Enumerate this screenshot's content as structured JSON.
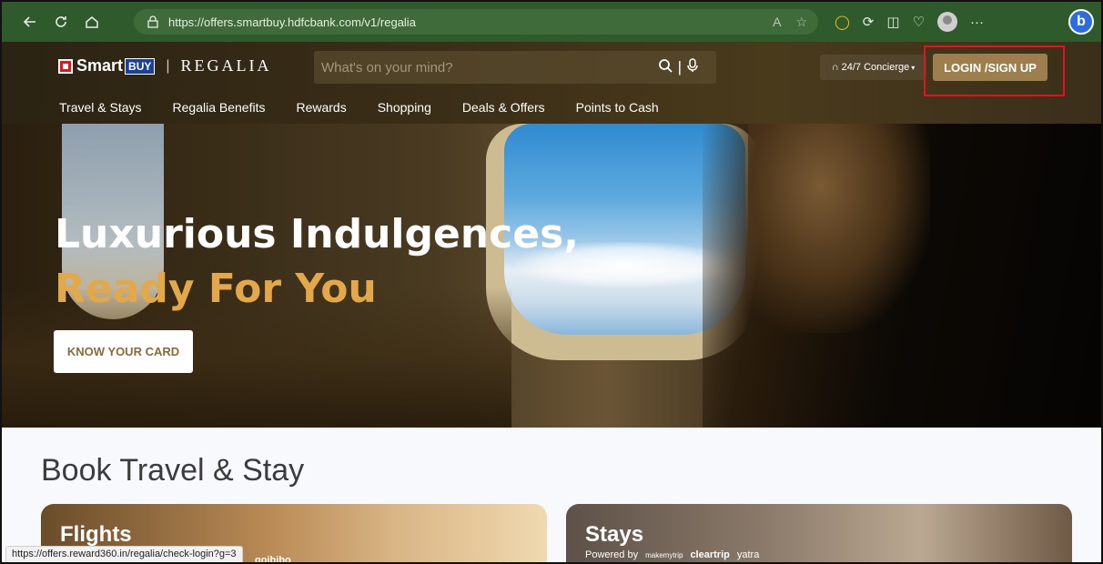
{
  "browser": {
    "url": "https://offers.smartbuy.hdfcbank.com/v1/regalia",
    "status_url": "https://offers.reward360.in/regalia/check-login?g=3"
  },
  "site": {
    "logo_smart": "Smart",
    "logo_buy": "BUY",
    "logo_regalia": "REGALIA",
    "search_placeholder": "What's on your mind?",
    "concierge_label": "24/7 Concierge",
    "login_label": "LOGIN /SIGN UP",
    "menu": [
      {
        "label": "Travel & Stays"
      },
      {
        "label": "Regalia Benefits"
      },
      {
        "label": "Rewards"
      },
      {
        "label": "Shopping"
      },
      {
        "label": "Deals & Offers"
      },
      {
        "label": "Points to Cash"
      }
    ]
  },
  "hero": {
    "title_line1": "Luxurious Indulgences,",
    "title_line2": "Ready For You",
    "button_label": "KNOW YOUR CARD"
  },
  "travel": {
    "section_title": "Book Travel & Stay",
    "flights": {
      "title": "Flights",
      "partner": "goibibo"
    },
    "stays": {
      "title": "Stays",
      "powered_by": "Powered by",
      "partners": [
        "makemytrip",
        "cleartrip",
        "yatra"
      ]
    }
  },
  "colors": {
    "chrome_green": "#2f5a2c",
    "gold_accent": "#e2a84a",
    "login_button": "#9c7f4d",
    "highlight_red": "#e0141c"
  }
}
